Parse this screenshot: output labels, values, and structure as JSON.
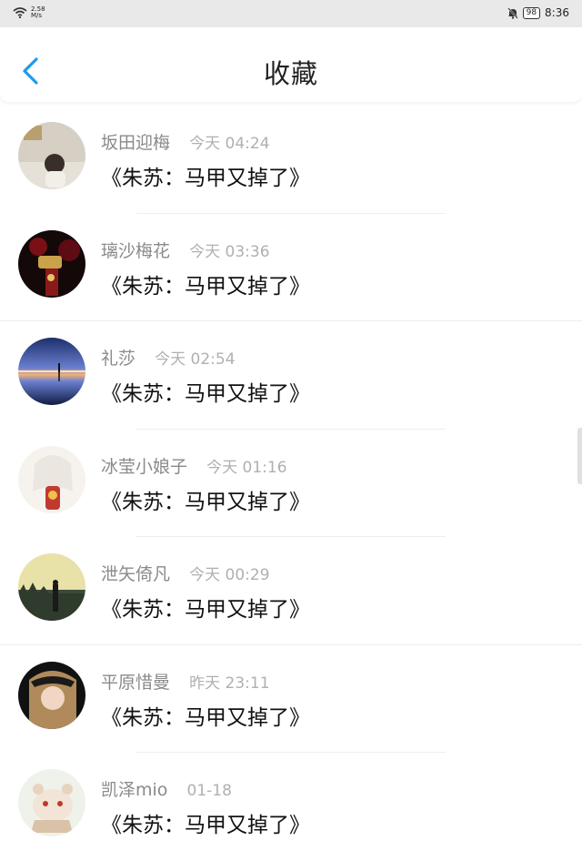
{
  "status_bar": {
    "net_speed_value": "2.58",
    "net_speed_unit": "M/s",
    "battery": "98",
    "time": "8:36"
  },
  "header": {
    "title": "收藏",
    "back_icon": "chevron-left-icon",
    "accent_color": "#1e9af0"
  },
  "favorites": [
    {
      "user": "坂田迎梅",
      "time": "今天 04:24",
      "title": "《朱苏：马甲又掉了》"
    },
    {
      "user": "璃沙梅花",
      "time": "今天 03:36",
      "title": "《朱苏：马甲又掉了》"
    },
    {
      "user": "礼莎",
      "time": "今天 02:54",
      "title": "《朱苏：马甲又掉了》"
    },
    {
      "user": "冰莹小娘子",
      "time": "今天 01:16",
      "title": "《朱苏：马甲又掉了》"
    },
    {
      "user": "泄矢倚凡",
      "time": "今天 00:29",
      "title": "《朱苏：马甲又掉了》"
    },
    {
      "user": "平原惜曼",
      "time": "昨天 23:11",
      "title": "《朱苏：马甲又掉了》"
    },
    {
      "user": "凯泽mio",
      "time": "01-18",
      "title": "《朱苏：马甲又掉了》"
    }
  ]
}
